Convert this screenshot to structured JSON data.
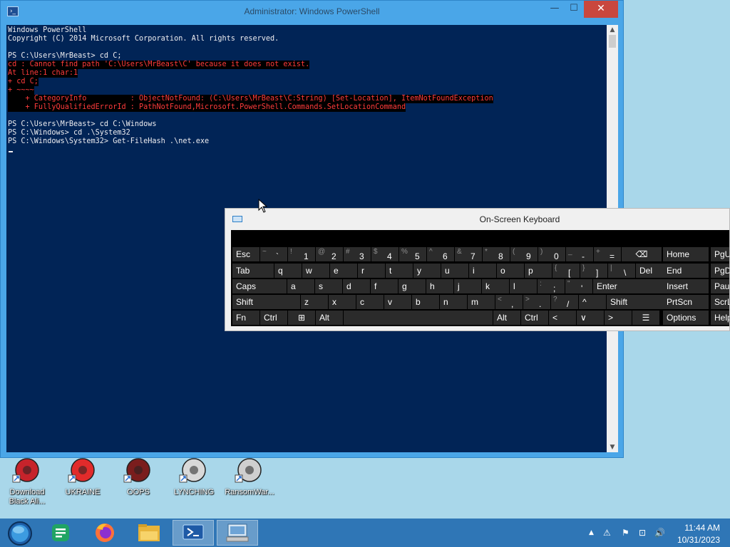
{
  "powershell": {
    "title": "Administrator: Windows PowerShell",
    "icon_glyph": "›_",
    "controls": {
      "minimize": "—",
      "maximize": "☐",
      "close": "✕"
    },
    "lines": [
      {
        "text": "Windows PowerShell",
        "err": false
      },
      {
        "text": "Copyright (C) 2014 Microsoft Corporation. All rights reserved.",
        "err": false
      },
      {
        "text": "",
        "err": false
      },
      {
        "text": "PS C:\\Users\\MrBeast> cd C;",
        "err": false
      },
      {
        "text": "cd : Cannot find path 'C:\\Users\\MrBeast\\C' because it does not exist.",
        "err": true
      },
      {
        "text": "At line:1 char:1",
        "err": true
      },
      {
        "text": "+ cd C;",
        "err": true
      },
      {
        "text": "+ ~~~~",
        "err": true
      },
      {
        "text": "    + CategoryInfo          : ObjectNotFound: (C:\\Users\\MrBeast\\C:String) [Set-Location], ItemNotFoundException",
        "err": true
      },
      {
        "text": "    + FullyQualifiedErrorId : PathNotFound,Microsoft.PowerShell.Commands.SetLocationCommand",
        "err": true
      },
      {
        "text": "",
        "err": false
      },
      {
        "text": "PS C:\\Users\\MrBeast> cd C:\\Windows",
        "err": false
      },
      {
        "text": "PS C:\\Windows> cd .\\System32",
        "err": false
      },
      {
        "text": "PS C:\\Windows\\System32> Get-FileHash .\\net.exe",
        "err": false
      }
    ]
  },
  "osk": {
    "title": "On-Screen Keyboard",
    "rows": [
      [
        {
          "label": "Esc",
          "w": 38
        },
        {
          "top": "~",
          "bot": "`",
          "w": 38
        },
        {
          "top": "!",
          "bot": "1",
          "w": 38
        },
        {
          "top": "@",
          "bot": "2",
          "w": 38
        },
        {
          "top": "#",
          "bot": "3",
          "w": 38
        },
        {
          "top": "$",
          "bot": "4",
          "w": 38
        },
        {
          "top": "%",
          "bot": "5",
          "w": 38
        },
        {
          "top": "^",
          "bot": "6",
          "w": 38
        },
        {
          "top": "&",
          "bot": "7",
          "w": 38
        },
        {
          "top": "*",
          "bot": "8",
          "w": 38
        },
        {
          "top": "(",
          "bot": "9",
          "w": 38
        },
        {
          "top": ")",
          "bot": "0",
          "w": 38
        },
        {
          "top": "_",
          "bot": "-",
          "w": 38
        },
        {
          "top": "+",
          "bot": "=",
          "w": 38
        },
        {
          "label": "⌫",
          "w": 56,
          "center": true
        }
      ],
      [
        {
          "label": "Tab",
          "w": 58
        },
        {
          "label": "q",
          "w": 38
        },
        {
          "label": "w",
          "w": 38
        },
        {
          "label": "e",
          "w": 38
        },
        {
          "label": "r",
          "w": 38
        },
        {
          "label": "t",
          "w": 38
        },
        {
          "label": "y",
          "w": 38
        },
        {
          "label": "u",
          "w": 38
        },
        {
          "label": "i",
          "w": 38
        },
        {
          "label": "o",
          "w": 38
        },
        {
          "label": "p",
          "w": 38
        },
        {
          "top": "{",
          "bot": "[",
          "w": 38
        },
        {
          "top": "}",
          "bot": "]",
          "w": 38
        },
        {
          "top": "|",
          "bot": "\\",
          "w": 38
        },
        {
          "label": "Del",
          "w": 48
        }
      ],
      [
        {
          "label": "Caps",
          "w": 76
        },
        {
          "label": "a",
          "w": 38
        },
        {
          "label": "s",
          "w": 38
        },
        {
          "label": "d",
          "w": 38
        },
        {
          "label": "f",
          "w": 38
        },
        {
          "label": "g",
          "w": 38
        },
        {
          "label": "h",
          "w": 38
        },
        {
          "label": "j",
          "w": 38
        },
        {
          "label": "k",
          "w": 38
        },
        {
          "label": "l",
          "w": 38
        },
        {
          "top": ":",
          "bot": ";",
          "w": 38
        },
        {
          "top": "\"",
          "bot": "'",
          "w": 38
        },
        {
          "label": "Enter",
          "w": 106
        }
      ],
      [
        {
          "label": "Shift",
          "w": 95
        },
        {
          "label": "z",
          "w": 38
        },
        {
          "label": "x",
          "w": 38
        },
        {
          "label": "c",
          "w": 38
        },
        {
          "label": "v",
          "w": 38
        },
        {
          "label": "b",
          "w": 38
        },
        {
          "label": "n",
          "w": 38
        },
        {
          "label": "m",
          "w": 38
        },
        {
          "top": "<",
          "bot": ",",
          "w": 38
        },
        {
          "top": ">",
          "bot": ".",
          "w": 38
        },
        {
          "top": "?",
          "bot": "/",
          "w": 38
        },
        {
          "label": "^",
          "w": 38
        },
        {
          "label": "Shift",
          "w": 87
        }
      ],
      [
        {
          "label": "Fn",
          "w": 38
        },
        {
          "label": "Ctrl",
          "w": 38
        },
        {
          "label": "⊞",
          "w": 38,
          "center": true
        },
        {
          "label": "Alt",
          "w": 38
        },
        {
          "label": "",
          "w": 209
        },
        {
          "label": "Alt",
          "w": 38
        },
        {
          "label": "Ctrl",
          "w": 38
        },
        {
          "label": "<",
          "w": 38
        },
        {
          "label": "∨",
          "w": 38
        },
        {
          "label": ">",
          "w": 38
        },
        {
          "label": "☰",
          "w": 38,
          "center": true
        }
      ]
    ],
    "nav": [
      [
        "Home",
        "PgUp"
      ],
      [
        "End",
        "PgDn"
      ],
      [
        "Insert",
        "Pause"
      ],
      [
        "PrtScn",
        "ScrLk"
      ],
      [
        "Options",
        "Help"
      ]
    ]
  },
  "desktop": {
    "icons": [
      {
        "label": "Download Black Ali...",
        "color": "#c6232b"
      },
      {
        "label": "UKRAINE",
        "color": "#e12b2b"
      },
      {
        "label": "OOPS",
        "color": "#7a1d1d"
      },
      {
        "label": "LYNCHING",
        "color": "#d9d9d9"
      },
      {
        "label": "RansomWar...",
        "color": "#cfcfcf"
      }
    ]
  },
  "taskbar": {
    "clock_time": "11:44 AM",
    "clock_date": "10/31/2023",
    "tray_icons": [
      "▲",
      "⚠",
      "⚑",
      "⊡",
      "🔊"
    ]
  }
}
